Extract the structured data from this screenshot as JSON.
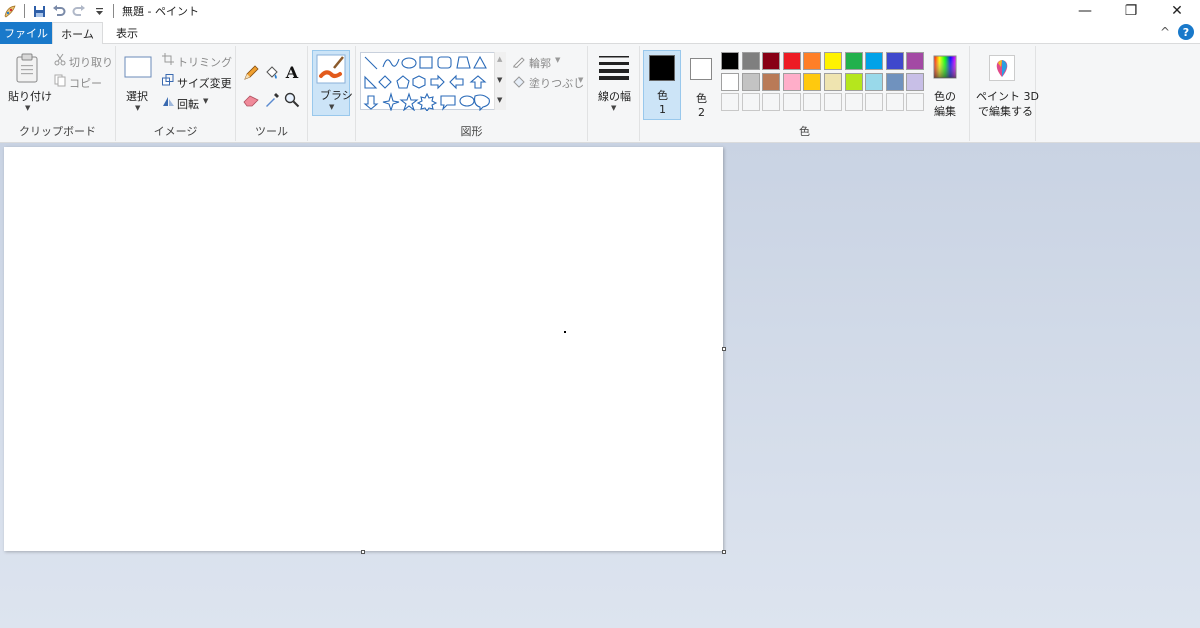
{
  "titlebar": {
    "title": "無題 - ペイント",
    "quick_access": [
      "paint-app-icon",
      "save-icon",
      "undo-icon",
      "redo-icon",
      "customize-icon"
    ],
    "controls": {
      "minimize": "—",
      "restore": "❐",
      "close": "✕"
    }
  },
  "tabs": {
    "file": "ファイル",
    "home": "ホーム",
    "view": "表示",
    "collapse": "^",
    "help": "?"
  },
  "clipboard": {
    "paste": "貼り付け",
    "cut": "切り取り",
    "copy": "コピー",
    "label": "クリップボード"
  },
  "image": {
    "select": "選択",
    "crop": "トリミング",
    "resize": "サイズ変更",
    "rotate": "回転",
    "label": "イメージ"
  },
  "tools": {
    "label": "ツール",
    "items": [
      "pencil-icon",
      "fill-icon",
      "text-icon",
      "eraser-icon",
      "color-picker-icon",
      "magnifier-icon"
    ]
  },
  "brush": {
    "label": "ブラシ"
  },
  "shapes": {
    "outline": "輪郭",
    "fill": "塗りつぶし",
    "label": "図形"
  },
  "size": {
    "label": "線の幅"
  },
  "colors": {
    "color1_top": "色",
    "color1_bottom": "1",
    "color2_top": "色",
    "color2_bottom": "2",
    "edit_top": "色の",
    "edit_bottom": "編集",
    "label": "色",
    "color1_value": "#000000",
    "color2_value": "#ffffff",
    "palette_row1": [
      "#000000",
      "#7f7f7f",
      "#880015",
      "#ed1c24",
      "#ff7f27",
      "#fff200",
      "#22b14c",
      "#00a2e8",
      "#3f48cc",
      "#a349a4"
    ],
    "palette_row2": [
      "#ffffff",
      "#c3c3c3",
      "#b97a57",
      "#ffaec9",
      "#ffc90e",
      "#efe4b0",
      "#b5e61d",
      "#99d9ea",
      "#7092be",
      "#c8bfe7"
    ]
  },
  "paint3d": {
    "line1": "ペイント 3D",
    "line2": "で編集する"
  }
}
